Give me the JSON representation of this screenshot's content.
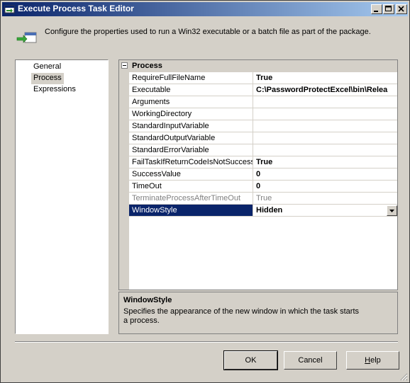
{
  "window": {
    "title": "Execute Process Task Editor"
  },
  "header": {
    "description": "Configure the properties used to run a Win32 executable or a batch file as part of the package."
  },
  "nav": {
    "items": [
      {
        "label": "General"
      },
      {
        "label": "Process",
        "selected": true
      },
      {
        "label": "Expressions"
      }
    ]
  },
  "grid": {
    "category": "Process",
    "rows": [
      {
        "name": "RequireFullFileName",
        "value": "True"
      },
      {
        "name": "Executable",
        "value": "C:\\PasswordProtectExcel\\bin\\Relea"
      },
      {
        "name": "Arguments",
        "value": ""
      },
      {
        "name": "WorkingDirectory",
        "value": ""
      },
      {
        "name": "StandardInputVariable",
        "value": ""
      },
      {
        "name": "StandardOutputVariable",
        "value": ""
      },
      {
        "name": "StandardErrorVariable",
        "value": ""
      },
      {
        "name": "FailTaskIfReturnCodeIsNotSuccess",
        "value": "True"
      },
      {
        "name": "SuccessValue",
        "value": "0"
      },
      {
        "name": "TimeOut",
        "value": "0"
      },
      {
        "name": "TerminateProcessAfterTimeOut",
        "value": "True",
        "disabled": true
      },
      {
        "name": "WindowStyle",
        "value": "Hidden",
        "selected": true
      }
    ]
  },
  "description": {
    "title": "WindowStyle",
    "text": "Specifies the appearance of the new window in which the task starts a process."
  },
  "buttons": {
    "ok": "OK",
    "cancel": "Cancel",
    "help_underlined": "H",
    "help_rest": "elp"
  }
}
